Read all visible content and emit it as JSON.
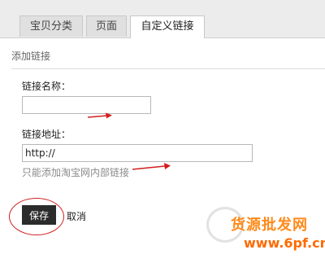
{
  "tabs": [
    {
      "label": "宝贝分类"
    },
    {
      "label": "页面"
    },
    {
      "label": "自定义链接"
    }
  ],
  "section": {
    "title": "添加链接"
  },
  "form": {
    "name_label": "链接名称：",
    "name_value": "",
    "url_label": "链接地址：",
    "url_value": "http://",
    "url_hint": "只能添加淘宝网内部链接"
  },
  "actions": {
    "save_label": "保存",
    "cancel_label": "取消"
  },
  "watermark": {
    "line1": "货源批发网",
    "line2": "www.6pf.cn"
  },
  "colors": {
    "annotation_red": "#d21e1e",
    "watermark_orange": "#ff8a1a"
  }
}
